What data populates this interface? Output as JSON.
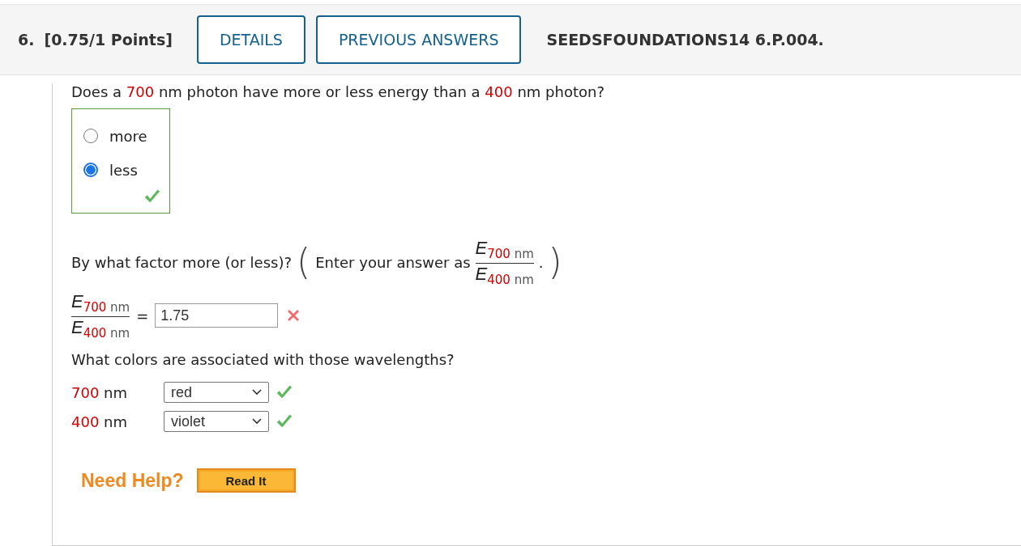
{
  "header": {
    "number": "6.",
    "points": "[0.75/1 Points]",
    "buttons": [
      "DETAILS",
      "PREVIOUS ANSWERS"
    ],
    "code": "SEEDSFOUNDATIONS14 6.P.004."
  },
  "question1": {
    "segments": [
      {
        "text": "Does a ",
        "highlight": false
      },
      {
        "text": "700",
        "highlight": true
      },
      {
        "text": " nm photon have more or less energy than a ",
        "highlight": false
      },
      {
        "text": "400",
        "highlight": true
      },
      {
        "text": " nm photon?",
        "highlight": false
      }
    ],
    "options": [
      {
        "label": "more",
        "selected": false
      },
      {
        "label": "less",
        "selected": true
      }
    ],
    "correct": true
  },
  "question2": {
    "prompt": "By what factor more (or less)?",
    "open_paren": "(",
    "hint": "Enter your answer as",
    "hint_end": ".",
    "close_paren": ")",
    "hint_fraction": {
      "numerator": {
        "symbol": "E",
        "value": "700",
        "unit": "nm"
      },
      "denominator": {
        "symbol": "E",
        "value": "400",
        "unit": "nm"
      }
    },
    "answer_fraction": {
      "numerator": {
        "symbol": "E",
        "value": "700",
        "unit": "nm"
      },
      "denominator": {
        "symbol": "E",
        "value": "400",
        "unit": "nm"
      }
    },
    "equals": "=",
    "value": "1.75",
    "correct": false
  },
  "question3": {
    "prompt": "What colors are associated with those wavelengths?",
    "rows": [
      {
        "value": "700",
        "unit": "nm",
        "selection": "red",
        "correct": true
      },
      {
        "value": "400",
        "unit": "nm",
        "selection": "violet",
        "correct": true
      }
    ]
  },
  "help": {
    "label": "Need Help?",
    "button": "Read It"
  }
}
